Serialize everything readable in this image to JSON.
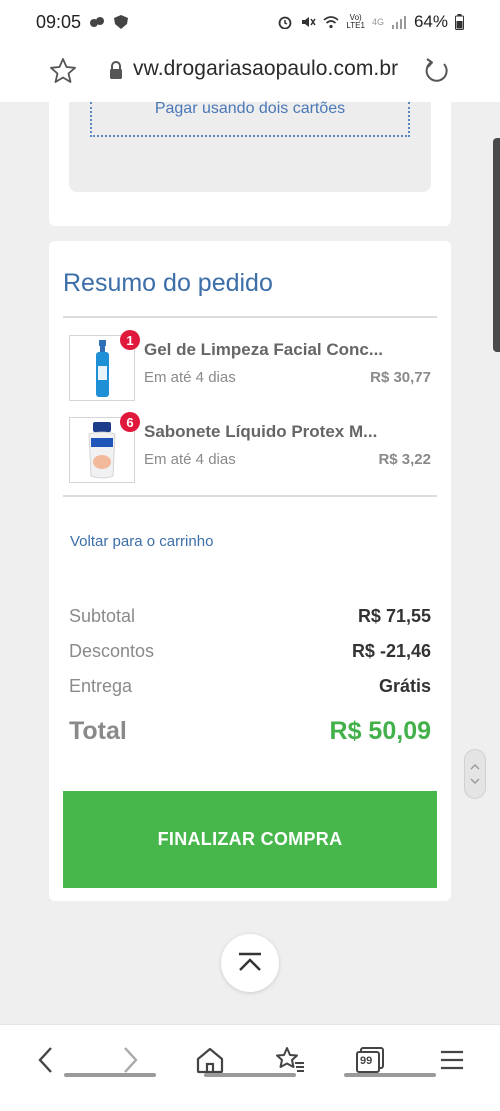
{
  "status_bar": {
    "time": "09:05",
    "battery": "64%",
    "network_top": "Vo)",
    "network_bottom": "LTE1",
    "network_type": "4G"
  },
  "url_bar": {
    "url": "vw.drogariasaopaulo.com.br"
  },
  "payment": {
    "two_cards_label": "Pagar usando dois cartões"
  },
  "summary": {
    "title": "Resumo do pedido",
    "items": [
      {
        "qty": "1",
        "name": "Gel de Limpeza Facial Conc...",
        "eta": "Em até 4 dias",
        "price": "R$ 30,77",
        "thumb_icon": "la-roche-posay-gel-bottle"
      },
      {
        "qty": "6",
        "name": "Sabonete Líquido Protex M...",
        "eta": "Em até 4 dias",
        "price": "R$ 3,22",
        "thumb_icon": "protex-liquid-soap-bottle"
      }
    ],
    "back_link": "Voltar para o carrinho",
    "subtotal_label": "Subtotal",
    "subtotal_value": "R$ 71,55",
    "discount_label": "Descontos",
    "discount_value": "R$ -21,46",
    "shipping_label": "Entrega",
    "shipping_value": "Grátis",
    "total_label": "Total",
    "total_value": "R$ 50,09",
    "finalize_label": "FINALIZAR COMPRA"
  },
  "bottom_nav": {
    "icons": [
      "back-icon",
      "forward-icon",
      "home-icon",
      "bookmarks-icon",
      "tabs-icon",
      "menu-icon"
    ],
    "tabs_count": "99"
  },
  "colors": {
    "accent_blue": "#3c6ea8",
    "success_green": "#47b64b",
    "badge_red": "#e0193c"
  }
}
